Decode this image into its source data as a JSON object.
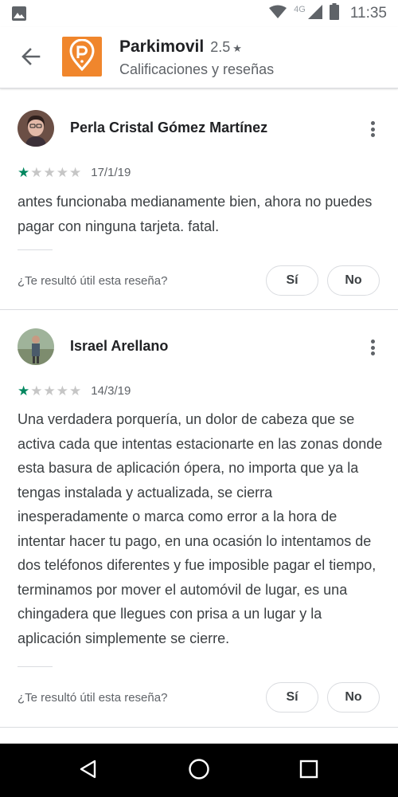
{
  "status_bar": {
    "network_label": "4G",
    "time": "11:35",
    "icons": [
      "image-icon",
      "wifi-icon",
      "signal-icon",
      "battery-icon"
    ]
  },
  "header": {
    "app_name": "Parkimovil",
    "rating": "2.5",
    "rating_star": "★",
    "subtitle": "Calificaciones y reseñas",
    "accent_color": "#f0862c"
  },
  "reviews": [
    {
      "author": "Perla Cristal Gómez Martínez",
      "stars": [
        "★",
        "★",
        "★",
        "★",
        "★"
      ],
      "rating": 1,
      "date": "17/1/19",
      "text": "antes funcionaba medianamente bien, ahora no puedes pagar con ninguna tarjeta. fatal.",
      "helpful_question": "¿Te resultó útil esta reseña?",
      "yes_label": "Sí",
      "no_label": "No"
    },
    {
      "author": "Israel Arellano",
      "stars": [
        "★",
        "★",
        "★",
        "★",
        "★"
      ],
      "rating": 1,
      "date": "14/3/19",
      "text": "Una verdadera porquería, un dolor de cabeza que se activa cada que intentas estacionarte en las zonas donde esta basura de aplicación ópera, no importa que ya la tengas instalada y actualizada, se cierra inesperadamente o marca como error a la hora de intentar hacer tu pago, en una ocasión lo intentamos de dos teléfonos diferentes y fue imposible pagar el tiempo, terminamos por mover el automóvil de lugar, es una chingadera que llegues con prisa a un lugar y la aplicación simplemente se cierre.",
      "helpful_question": "¿Te resultó útil esta reseña?",
      "yes_label": "Sí",
      "no_label": "No"
    }
  ],
  "colors": {
    "star_filled": "#01875f",
    "star_empty": "#c6c6c6"
  }
}
